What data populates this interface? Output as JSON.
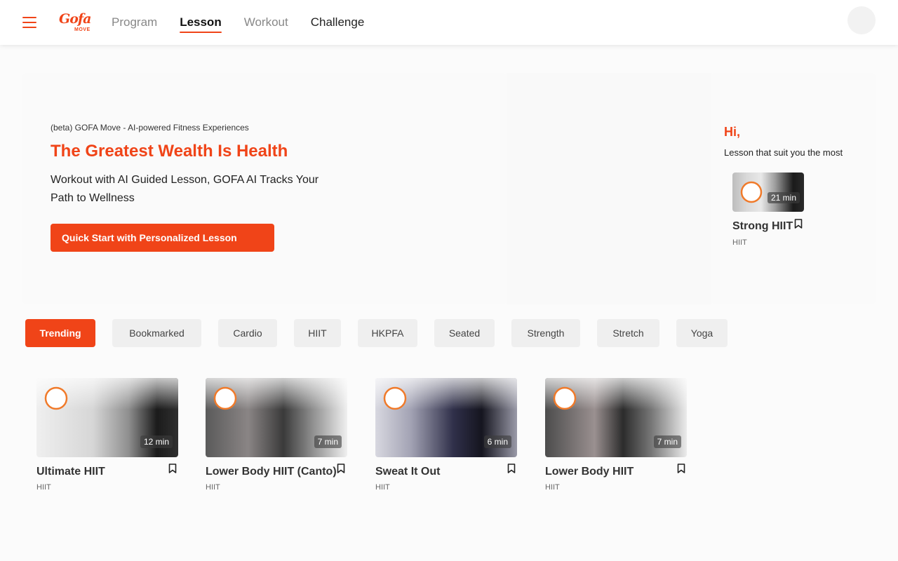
{
  "header": {
    "menu_icon": "hamburger-icon",
    "logo": {
      "brand": "Gofa",
      "sub": "MOVE"
    },
    "nav": [
      {
        "label": "Program",
        "state": "inactive"
      },
      {
        "label": "Lesson",
        "state": "active"
      },
      {
        "label": "Workout",
        "state": "inactive"
      },
      {
        "label": "Challenge",
        "state": "inactive"
      }
    ]
  },
  "hero": {
    "beta": "(beta) GOFA Move - AI-powered Fitness Experiences",
    "headline": "The Greatest Wealth Is Health",
    "subline": "Workout with AI Guided Lesson, GOFA AI Tracks Your Path to Wellness",
    "cta": "Quick Start with Personalized Lesson"
  },
  "recommend": {
    "greeting": "Hi,",
    "subtitle": "Lesson that suit you the most",
    "lesson": {
      "duration": "21 min",
      "title": "Strong HIIT",
      "category": "HIIT"
    }
  },
  "tabs": [
    "Trending",
    "Bookmarked",
    "Cardio",
    "HIIT",
    "HKPFA",
    "Seated",
    "Strength",
    "Stretch",
    "Yoga"
  ],
  "active_tab": "Trending",
  "lessons": [
    {
      "title": "Ultimate HIIT",
      "duration": "12 min",
      "category": "HIIT"
    },
    {
      "title": "Lower Body HIIT (Canto)",
      "duration": "7 min",
      "category": "HIIT"
    },
    {
      "title": "Sweat It Out",
      "duration": "6 min",
      "category": "HIIT"
    },
    {
      "title": "Lower Body HIIT",
      "duration": "7 min",
      "category": "HIIT"
    }
  ],
  "colors": {
    "accent": "#f04418",
    "tab_bg": "#efefef"
  }
}
